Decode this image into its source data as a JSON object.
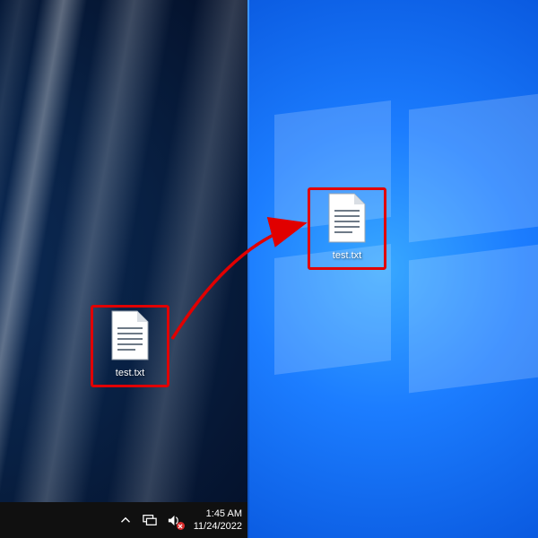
{
  "desktops": {
    "left_file_label": "test.txt",
    "right_file_label": "test.txt"
  },
  "taskbar": {
    "time": "1:45 AM",
    "date": "11/24/2022"
  },
  "annotation": {
    "action": "drag-copy-between-desktops",
    "arrow_color": "#e10000"
  }
}
